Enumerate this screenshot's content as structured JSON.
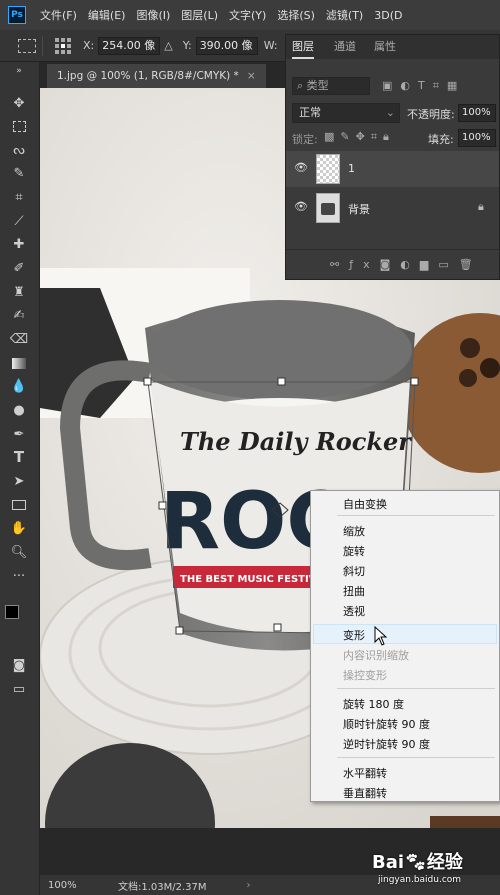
{
  "app": {
    "logo": "Ps"
  },
  "menu": [
    "文件(F)",
    "编辑(E)",
    "图像(I)",
    "图层(L)",
    "文字(Y)",
    "选择(S)",
    "滤镜(T)",
    "3D(D"
  ],
  "options": {
    "x_label": "X:",
    "x_value": "254.00 像",
    "y_label": "Y:",
    "y_value": "390.00 像",
    "w_label": "W:"
  },
  "document_tab": {
    "title": "1.jpg @ 100% (1, RGB/8#/CMYK) *",
    "close": "×"
  },
  "layers_panel": {
    "tabs": [
      "图层",
      "通道",
      "属性"
    ],
    "filter_label": "类型",
    "blend_mode": "正常",
    "opacity_label": "不透明度:",
    "opacity_value": "100%",
    "lock_label": "锁定:",
    "fill_label": "填充:",
    "fill_value": "100%",
    "layers": [
      {
        "name": "1",
        "selected": true
      },
      {
        "name": "背景",
        "locked": true
      }
    ]
  },
  "image_text": {
    "headline1": "The Daily Rocker",
    "headline2": "ROCK",
    "banner": "THE BEST MUSIC FESTIVAL"
  },
  "context_menu": {
    "items": [
      {
        "label": "自由变换",
        "enabled": true
      },
      {
        "label": "缩放",
        "enabled": true
      },
      {
        "label": "旋转",
        "enabled": true
      },
      {
        "label": "斜切",
        "enabled": true
      },
      {
        "label": "扭曲",
        "enabled": true
      },
      {
        "label": "透视",
        "enabled": true
      },
      {
        "label": "变形",
        "enabled": true,
        "hovered": true
      },
      {
        "label": "内容识别缩放",
        "enabled": false
      },
      {
        "label": "操控变形",
        "enabled": false
      },
      {
        "label": "旋转 180 度",
        "enabled": true
      },
      {
        "label": "顺时针旋转 90 度",
        "enabled": true
      },
      {
        "label": "逆时针旋转 90 度",
        "enabled": true
      },
      {
        "label": "水平翻转",
        "enabled": true
      },
      {
        "label": "垂直翻转",
        "enabled": true
      }
    ]
  },
  "status": {
    "zoom": "100%",
    "doc": "文档:1.03M/2.37M",
    "arrow": "›"
  },
  "watermark": {
    "brand": "Bai",
    "brand2": "经验",
    "url": "jingyan.baidu.com"
  },
  "colors": {
    "accent": "#31a8ff",
    "highlight": "#e5f1fb",
    "banner_red": "#c8283a"
  }
}
